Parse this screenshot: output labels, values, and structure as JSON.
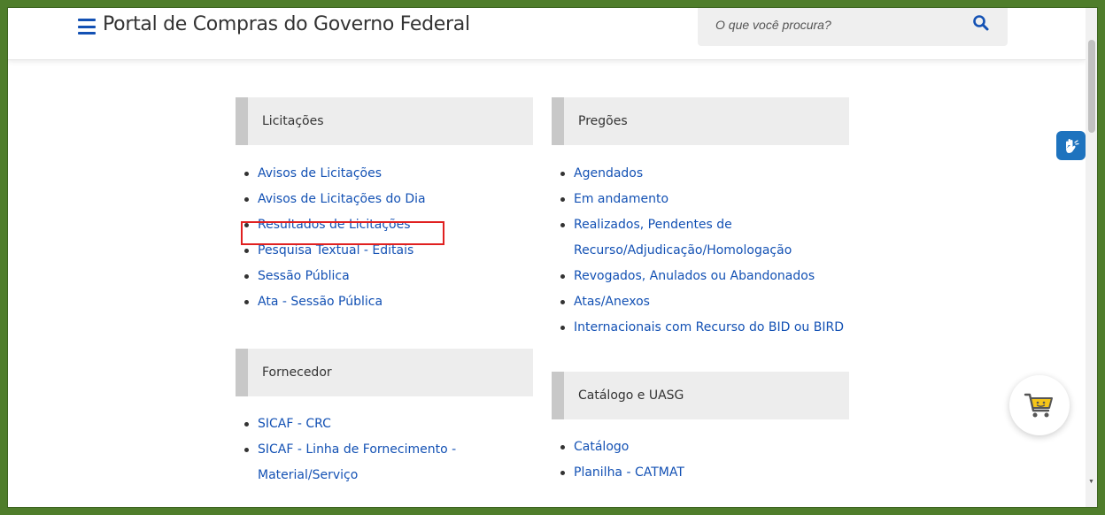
{
  "header": {
    "site_title": "Portal de Compras do Governo Federal",
    "search_placeholder": "O que você procura?"
  },
  "sections": {
    "licitacoes": {
      "title": "Licitações",
      "items": [
        "Avisos de Licitações",
        "Avisos de Licitações do Dia",
        "Resultados de Licitações",
        "Pesquisa Textual - Editais",
        "Sessão Pública",
        "Ata - Sessão Pública"
      ]
    },
    "pregoes": {
      "title": "Pregões",
      "items": [
        "Agendados",
        "Em andamento",
        "Realizados, Pendentes de",
        "Recurso/Adjudicação/Homologação",
        "Revogados, Anulados ou Abandonados",
        "Atas/Anexos",
        "Internacionais com Recurso do BID ou BIRD"
      ]
    },
    "fornecedor": {
      "title": "Fornecedor",
      "items": [
        "SICAF - CRC",
        "SICAF - Linha de Fornecimento -",
        "Material/Serviço"
      ]
    },
    "catalogo": {
      "title": "Catálogo e UASG",
      "items": [
        "Catálogo",
        "Planilha - CATMAT"
      ]
    }
  },
  "colors": {
    "link": "#1351b4",
    "frame": "#4f7d2b",
    "highlight": "#e02020",
    "section_bg": "#ededed",
    "section_accent": "#c8c8c8",
    "vlibras": "#1e73be",
    "cart": "#f5c518"
  },
  "icons": [
    "menu-icon",
    "search-icon",
    "vlibras-hands-icon",
    "shopping-cart-icon"
  ]
}
